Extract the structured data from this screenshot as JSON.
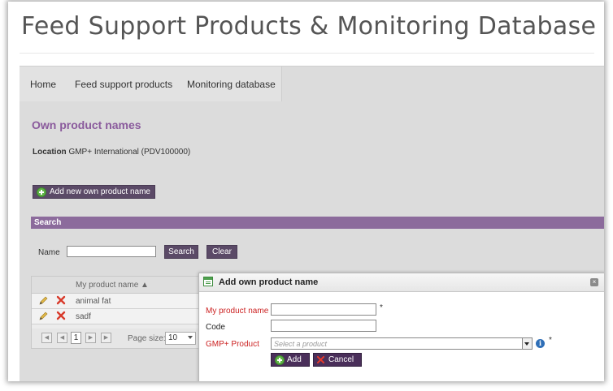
{
  "header": {
    "title": "Feed Support Products & Monitoring Database"
  },
  "nav": {
    "items": [
      {
        "label": "Home"
      },
      {
        "label": "Feed support products"
      },
      {
        "label": "Monitoring database"
      }
    ]
  },
  "main": {
    "section_title": "Own product names",
    "location_label": "Location",
    "location_value": "GMP+ International (PDV100000)",
    "add_new_label": "Add new own product name"
  },
  "search": {
    "header": "Search",
    "name_label": "Name",
    "name_value": "",
    "search_label": "Search",
    "clear_label": "Clear"
  },
  "grid": {
    "column_header": "My product name ▲",
    "rows": [
      {
        "name": "animal fat"
      },
      {
        "name": "sadf"
      }
    ],
    "pager": {
      "current_page": "1",
      "page_size_label": "Page size:",
      "page_size_value": "10"
    }
  },
  "dialog": {
    "title": "Add own product name",
    "close_glyph": "×",
    "fields": {
      "product_name_label": "My product name",
      "product_name_value": "",
      "code_label": "Code",
      "code_value": "",
      "gmp_label": "GMP+ Product",
      "gmp_placeholder": "Select a product"
    },
    "required_marker": "*",
    "info_glyph": "i",
    "add_label": "Add",
    "cancel_label": "Cancel"
  },
  "colors": {
    "accent_purple": "#8c6b9c",
    "button_purple": "#5b4a67",
    "required_red": "#cc2222",
    "title_purple": "#8a5a9c"
  },
  "icons": [
    "plus-icon",
    "pencil-icon",
    "delete-x-icon",
    "form-icon",
    "close-icon",
    "info-icon",
    "first-page-icon",
    "prev-page-icon",
    "next-page-icon",
    "last-page-icon"
  ]
}
